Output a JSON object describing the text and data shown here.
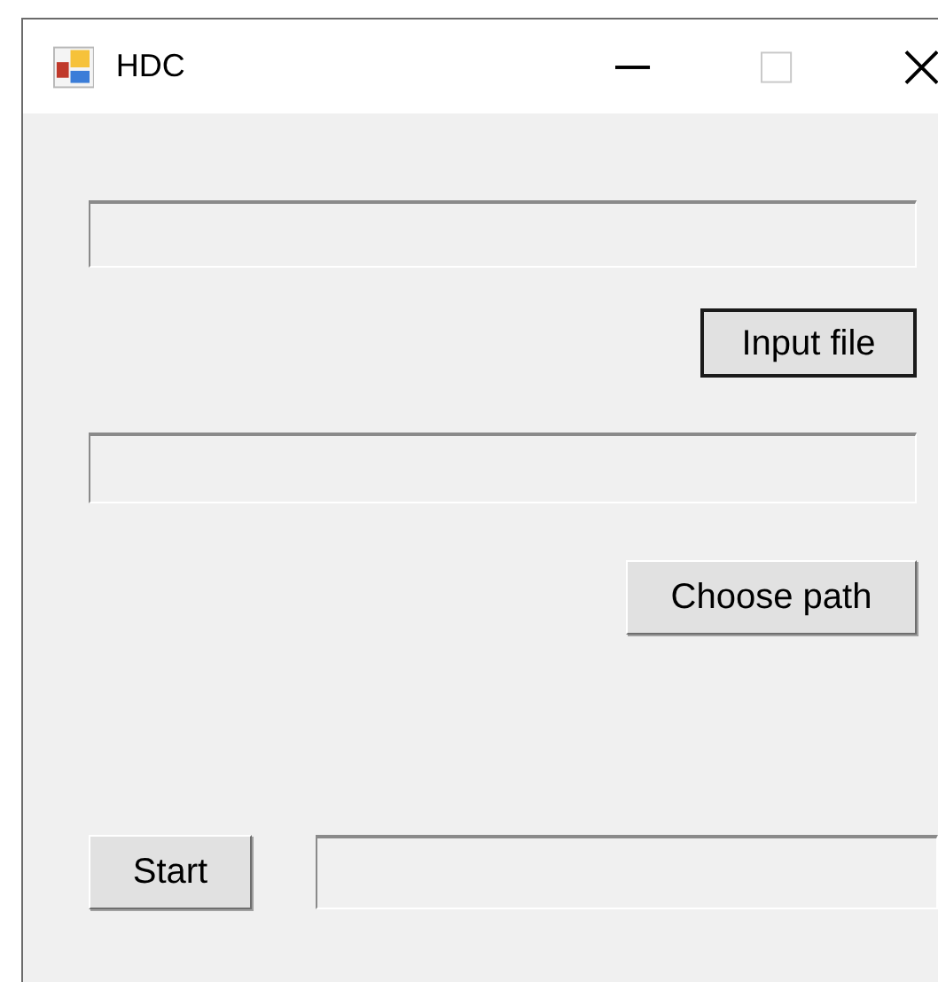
{
  "window": {
    "title": "HDC"
  },
  "input_file_button": {
    "label": "Input file",
    "focused": true
  },
  "choose_path_button": {
    "label": "Choose path",
    "focused": false
  },
  "start_button": {
    "label": "Start",
    "focused": false
  }
}
